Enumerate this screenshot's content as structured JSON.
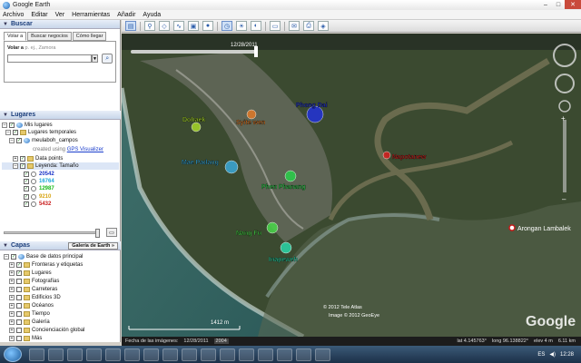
{
  "window": {
    "title": "Google Earth",
    "controls": [
      "–",
      "□",
      "✕"
    ]
  },
  "menu": [
    "Archivo",
    "Editar",
    "Ver",
    "Herramientas",
    "Añadir",
    "Ayuda"
  ],
  "search": {
    "header": "Buscar",
    "tabs": [
      "Volar a",
      "Buscar negocios",
      "Cómo llegar"
    ],
    "label": "Volar a",
    "hint": "p. ej., Zamora",
    "value": ""
  },
  "places": {
    "header": "Lugares",
    "items": [
      {
        "label": "Mis lugares",
        "checked": true,
        "icon": "globe"
      },
      {
        "label": "Lugares temporales",
        "checked": true,
        "icon": "folder"
      },
      {
        "label": "meulaboh_campos",
        "checked": true,
        "icon": "globe"
      },
      {
        "label": "created using",
        "link": "GPS Visualizer"
      },
      {
        "label": "Data points",
        "checked": true,
        "icon": "folder"
      },
      {
        "label": "Leyenda: Tamaño",
        "checked": true,
        "icon": "folder"
      }
    ],
    "legend": [
      {
        "value": "20542",
        "color": "#1a33c8"
      },
      {
        "value": "16764",
        "color": "#1aa5d8"
      },
      {
        "value": "12987",
        "color": "#14b814"
      },
      {
        "value": "9210",
        "color": "#d8a514"
      },
      {
        "value": "5432",
        "color": "#c81a1a"
      }
    ]
  },
  "layers": {
    "header": "Capas",
    "gallery": "Galería de Earth »",
    "items": [
      "Base de datos principal",
      "Fronteras y etiquetas",
      "Lugares",
      "Fotografías",
      "Carreteras",
      "Edificios 3D",
      "Océanos",
      "Tiempo",
      "Galería",
      "Concienciación global",
      "Más"
    ],
    "checked": [
      true,
      true,
      true,
      false,
      false,
      false,
      false,
      false,
      false,
      false,
      false
    ]
  },
  "timeline": {
    "date": "12/28/2011"
  },
  "map": {
    "markers": [
      {
        "label": "Phong Dai",
        "color": "#2232d8"
      },
      {
        "label": "Syite wen",
        "color": "#e07a28"
      },
      {
        "label": "Dohaek",
        "color": "#a8d82a"
      },
      {
        "label": "Mae Padang",
        "color": "#3aa8d8"
      },
      {
        "label": "Phen Phanang",
        "color": "#2ad04a"
      },
      {
        "label": "Nang Fu",
        "color": "#4ad84a"
      },
      {
        "label": "Inapeweh",
        "color": "#2ad8a8"
      },
      {
        "label": "Napotanew",
        "color": "#d82020"
      }
    ],
    "place_label": "Arongan Lambalek",
    "credits": [
      "© 2012 Tele Atlas",
      "Image © 2012 GeoEye"
    ],
    "scale": "1412 m",
    "brand": "Google"
  },
  "status": {
    "imagery_date_label": "Fecha de las imágenes:",
    "imagery_date": "12/28/2011",
    "year": "2004",
    "lat": "lat   4.145763°",
    "lon": "long   96.138822°",
    "elev": "elev   4 m",
    "eye": "6.11 km"
  },
  "taskbar": {
    "lang": "ES",
    "time": "12:28"
  }
}
